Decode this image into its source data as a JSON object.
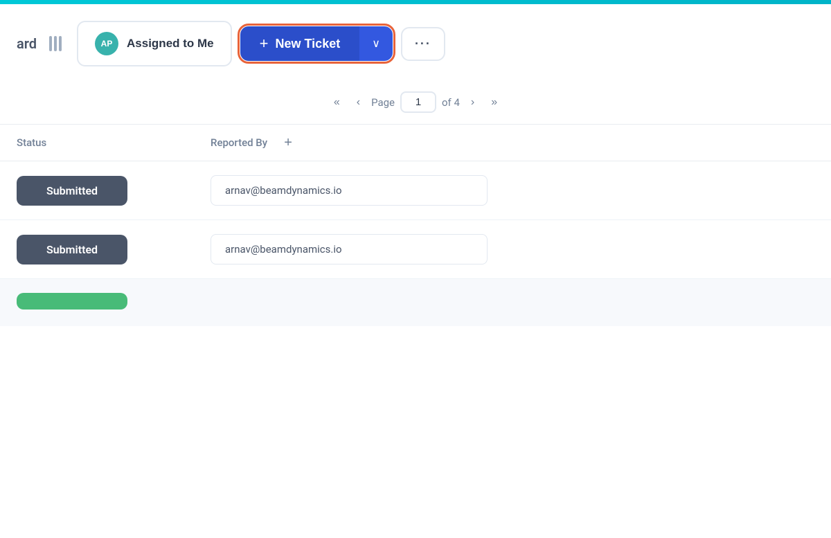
{
  "topbar": {
    "bg_color": "#00c8d7"
  },
  "toolbar": {
    "word_partial": "ard",
    "column_icon_label": "columns",
    "assigned_to_me": {
      "avatar_text": "AP",
      "label": "Assigned to Me"
    },
    "new_ticket": {
      "plus": "+",
      "label": "New Ticket",
      "dropdown_arrow": "∨"
    },
    "more_options": "···"
  },
  "pagination": {
    "first_label": "«",
    "prev_label": "‹",
    "page_label": "Page",
    "current_page": "1",
    "of_label": "of 4",
    "next_label": "›",
    "last_label": "»"
  },
  "table": {
    "col_status": "Status",
    "col_reported_by": "Reported By",
    "add_col_icon": "+",
    "rows": [
      {
        "status": "Submitted",
        "email": "arnav@beamdynamics.io",
        "status_color": "slate"
      },
      {
        "status": "Submitted",
        "email": "arnav@beamdynamics.io",
        "status_color": "slate"
      },
      {
        "status": "",
        "email": "",
        "status_color": "green"
      }
    ]
  }
}
